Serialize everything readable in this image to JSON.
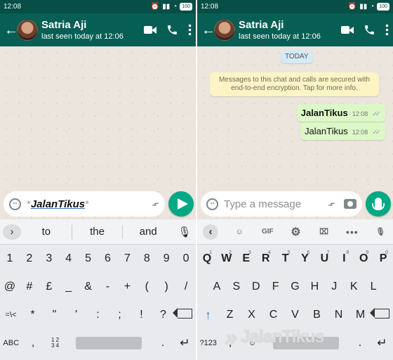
{
  "left": {
    "status_time": "12:08",
    "battery": "100",
    "contact_name": "Satria Aji",
    "last_seen": "last seen today at 12:06",
    "composer": {
      "asterisk_open": "*",
      "typed_text": "JalanTikus",
      "asterisk_close": "*"
    },
    "suggestions": [
      "to",
      "the",
      "and"
    ],
    "keyboard": {
      "numbers": [
        "1",
        "2",
        "3",
        "4",
        "5",
        "6",
        "7",
        "8",
        "9",
        "0"
      ],
      "symbols_row_1": [
        "@",
        "#",
        "£",
        "_",
        "&",
        "-",
        "+",
        "(",
        ")",
        "/"
      ],
      "symbols_row_2": [
        "=\\<",
        "*",
        "\"",
        "'",
        ":",
        ";",
        "!",
        "?"
      ],
      "bottom": {
        "mode": "ABC",
        "comma": ",",
        "number_stack": "1 2\n3 4",
        "period": "."
      }
    }
  },
  "right": {
    "status_time": "12:08",
    "battery": "100",
    "contact_name": "Satria Aji",
    "last_seen": "last seen today at 12:06",
    "date_chip": "TODAY",
    "encryption_note": "Messages to this chat and calls are secured with end-to-end encryption. Tap for more info.",
    "messages": [
      {
        "text": "JalanTikus",
        "time": "12:08",
        "bold": true
      },
      {
        "text": "JalanTikus",
        "time": "12:08",
        "bold": false
      }
    ],
    "composer_placeholder": "Type a message",
    "keyboard_toolbar": {
      "gif": "GIF"
    },
    "keyboard": {
      "row_1": [
        "Q",
        "W",
        "E",
        "R",
        "T",
        "Y",
        "U",
        "I",
        "O",
        "P"
      ],
      "row_1_numbers": [
        "1",
        "2",
        "3",
        "4",
        "5",
        "6",
        "7",
        "8",
        "9",
        "0"
      ],
      "row_2": [
        "A",
        "S",
        "D",
        "F",
        "G",
        "H",
        "J",
        "K",
        "L"
      ],
      "row_3": [
        "Z",
        "X",
        "C",
        "V",
        "B",
        "N",
        "M"
      ],
      "bottom": {
        "mode": "?123",
        "comma": ",",
        "period": "."
      }
    }
  },
  "watermark": "JalanTikus",
  "colors": {
    "header": "#075e54",
    "accent": "#00a884",
    "bubble": "#dcf8c6"
  }
}
